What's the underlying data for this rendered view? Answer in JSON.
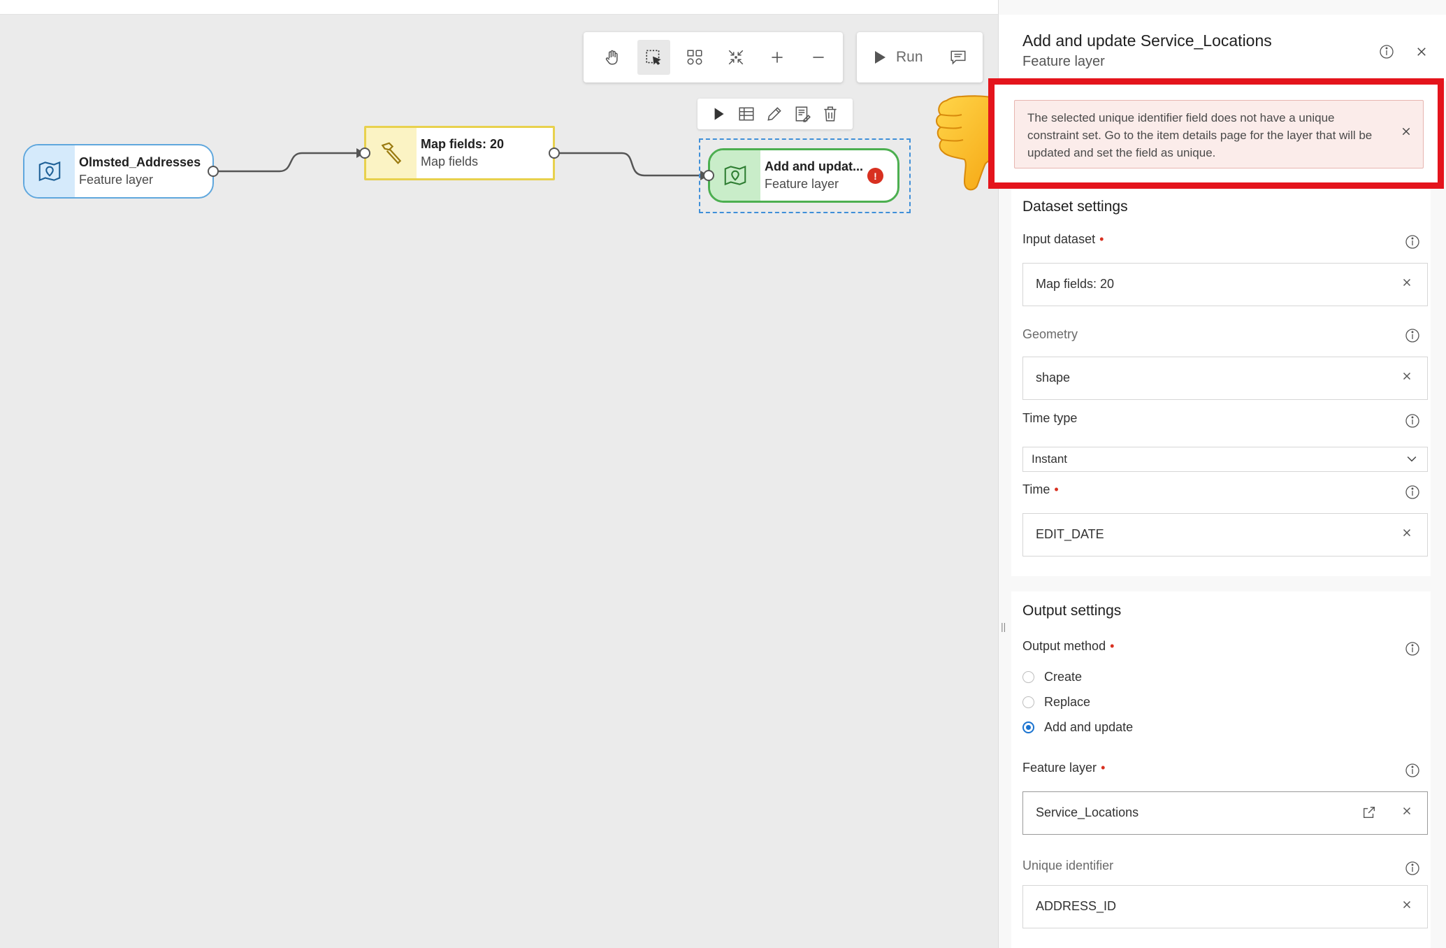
{
  "toolbar": {
    "tools": [
      "pan-icon",
      "select-icon",
      "auto-layout-icon",
      "fit-icon",
      "zoom-in-icon",
      "zoom-out-icon"
    ],
    "run_label": "Run"
  },
  "node_actions": [
    "run-icon",
    "table-icon",
    "edit-icon",
    "notes-icon",
    "delete-icon"
  ],
  "nodes": {
    "n1": {
      "title": "Olmsted_Addresses",
      "subtitle": "Feature layer"
    },
    "n2": {
      "title": "Map fields: 20",
      "subtitle": "Map fields"
    },
    "n3": {
      "title": "Add and updat...",
      "subtitle": "Feature layer",
      "error_glyph": "!"
    }
  },
  "panel": {
    "title": "Add and update Service_Locations",
    "subtitle": "Feature layer",
    "alert": "The selected unique identifier field does not have a unique constraint set. Go to the item details page for the layer that will be updated and set the field as unique.",
    "dataset": {
      "heading": "Dataset settings",
      "input_label": "Input dataset",
      "input_value": "Map fields: 20",
      "geometry_label": "Geometry",
      "geometry_value": "shape",
      "timetype_label": "Time type",
      "timetype_value": "Instant",
      "time_label": "Time",
      "time_value": "EDIT_DATE"
    },
    "output": {
      "heading": "Output settings",
      "method_label": "Output method",
      "options": [
        "Create",
        "Replace",
        "Add and update"
      ],
      "selected": "Add and update",
      "layer_label": "Feature layer",
      "layer_value": "Service_Locations",
      "uid_label": "Unique identifier",
      "uid_value": "ADDRESS_ID"
    }
  },
  "colors": {
    "accent": "#1a73d0",
    "error": "#d83020",
    "node_blue": "#5fa7dd",
    "node_yellow": "#e8d14d",
    "node_green": "#4caf50",
    "highlight": "#e4141c"
  }
}
